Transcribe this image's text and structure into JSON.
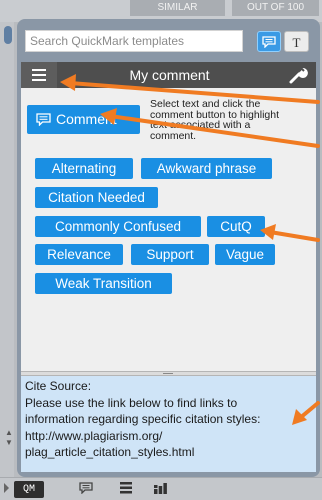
{
  "background_tabs": [
    "SIMILAR",
    "OUT OF 100"
  ],
  "search": {
    "placeholder": "Search QuickMark templates"
  },
  "mode_toggle": {
    "comment_icon": "speech-bubble-icon",
    "text_label": "T"
  },
  "header": {
    "title": "My comment",
    "menu_icon": "hamburger-icon",
    "settings_icon": "wrench-icon"
  },
  "comment_button": {
    "label": "Comment",
    "icon": "speech-bubble-icon"
  },
  "hint_lines": [
    "Select text and click the",
    "comment button to highlight",
    "text associated with a",
    "comment."
  ],
  "tags": [
    "Alternating",
    "Awkward phrase",
    "Citation Needed",
    "Commonly Confused",
    "CutQ",
    "Relevance",
    "Support",
    "Vague",
    "Weak Transition"
  ],
  "info_lines": [
    "Cite Source:",
    "Please use the link below to find links to",
    "information regarding specific citation styles:",
    "http://www.plagiarism.org/",
    "plag_article_citation_styles.html"
  ],
  "bottom_bar": {
    "qm_label": "QM",
    "icons": [
      "speech-bubble-icon",
      "list-icon",
      "grid-icon"
    ]
  },
  "colors": {
    "accent": "#1a8fe3",
    "header": "#4e4e4e",
    "info_bg": "#cfe4f7",
    "annotation_arrow": "#f07b22"
  }
}
